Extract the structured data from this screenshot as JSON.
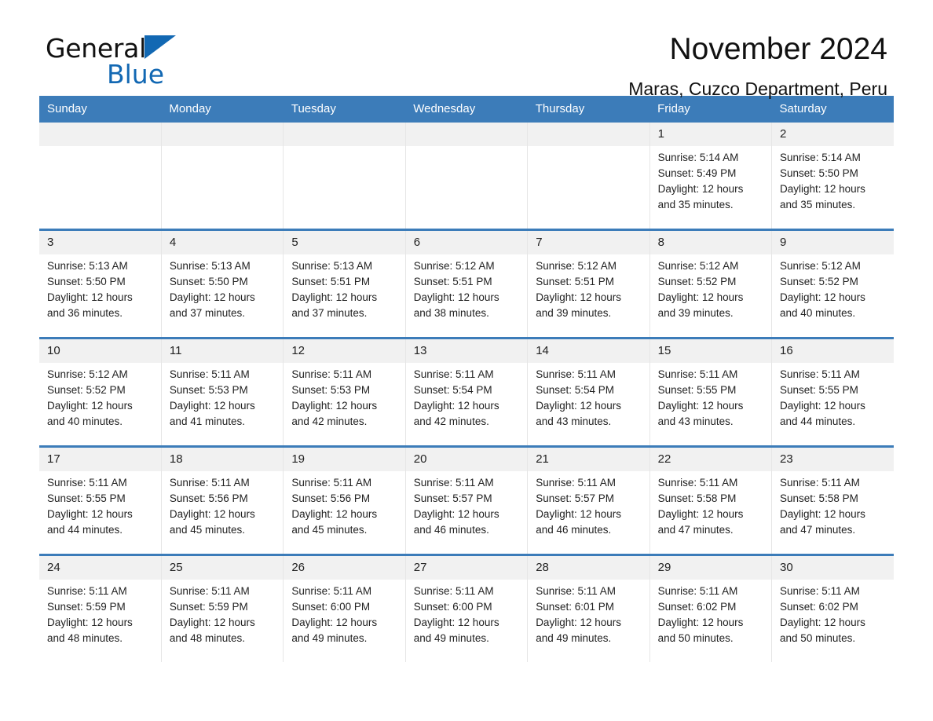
{
  "brand": {
    "name_part1": "General",
    "name_part2": "Blue",
    "accent_color": "#1268b3"
  },
  "header": {
    "title": "November 2024",
    "subtitle": "Maras, Cuzco Department, Peru"
  },
  "theme": {
    "header_bg": "#3c7cb9",
    "daynum_bg": "#f1f1f1",
    "cell_bg": "#ffffff"
  },
  "weekday_headers": [
    "Sunday",
    "Monday",
    "Tuesday",
    "Wednesday",
    "Thursday",
    "Friday",
    "Saturday"
  ],
  "weeks": [
    [
      {
        "day": "",
        "sunrise": "",
        "sunset": "",
        "daylight_line1": "",
        "daylight_line2": "",
        "blank": true
      },
      {
        "day": "",
        "sunrise": "",
        "sunset": "",
        "daylight_line1": "",
        "daylight_line2": "",
        "blank": true
      },
      {
        "day": "",
        "sunrise": "",
        "sunset": "",
        "daylight_line1": "",
        "daylight_line2": "",
        "blank": true
      },
      {
        "day": "",
        "sunrise": "",
        "sunset": "",
        "daylight_line1": "",
        "daylight_line2": "",
        "blank": true
      },
      {
        "day": "",
        "sunrise": "",
        "sunset": "",
        "daylight_line1": "",
        "daylight_line2": "",
        "blank": true
      },
      {
        "day": "1",
        "sunrise": "Sunrise: 5:14 AM",
        "sunset": "Sunset: 5:49 PM",
        "daylight_line1": "Daylight: 12 hours",
        "daylight_line2": "and 35 minutes.",
        "blank": false
      },
      {
        "day": "2",
        "sunrise": "Sunrise: 5:14 AM",
        "sunset": "Sunset: 5:50 PM",
        "daylight_line1": "Daylight: 12 hours",
        "daylight_line2": "and 35 minutes.",
        "blank": false
      }
    ],
    [
      {
        "day": "3",
        "sunrise": "Sunrise: 5:13 AM",
        "sunset": "Sunset: 5:50 PM",
        "daylight_line1": "Daylight: 12 hours",
        "daylight_line2": "and 36 minutes.",
        "blank": false
      },
      {
        "day": "4",
        "sunrise": "Sunrise: 5:13 AM",
        "sunset": "Sunset: 5:50 PM",
        "daylight_line1": "Daylight: 12 hours",
        "daylight_line2": "and 37 minutes.",
        "blank": false
      },
      {
        "day": "5",
        "sunrise": "Sunrise: 5:13 AM",
        "sunset": "Sunset: 5:51 PM",
        "daylight_line1": "Daylight: 12 hours",
        "daylight_line2": "and 37 minutes.",
        "blank": false
      },
      {
        "day": "6",
        "sunrise": "Sunrise: 5:12 AM",
        "sunset": "Sunset: 5:51 PM",
        "daylight_line1": "Daylight: 12 hours",
        "daylight_line2": "and 38 minutes.",
        "blank": false
      },
      {
        "day": "7",
        "sunrise": "Sunrise: 5:12 AM",
        "sunset": "Sunset: 5:51 PM",
        "daylight_line1": "Daylight: 12 hours",
        "daylight_line2": "and 39 minutes.",
        "blank": false
      },
      {
        "day": "8",
        "sunrise": "Sunrise: 5:12 AM",
        "sunset": "Sunset: 5:52 PM",
        "daylight_line1": "Daylight: 12 hours",
        "daylight_line2": "and 39 minutes.",
        "blank": false
      },
      {
        "day": "9",
        "sunrise": "Sunrise: 5:12 AM",
        "sunset": "Sunset: 5:52 PM",
        "daylight_line1": "Daylight: 12 hours",
        "daylight_line2": "and 40 minutes.",
        "blank": false
      }
    ],
    [
      {
        "day": "10",
        "sunrise": "Sunrise: 5:12 AM",
        "sunset": "Sunset: 5:52 PM",
        "daylight_line1": "Daylight: 12 hours",
        "daylight_line2": "and 40 minutes.",
        "blank": false
      },
      {
        "day": "11",
        "sunrise": "Sunrise: 5:11 AM",
        "sunset": "Sunset: 5:53 PM",
        "daylight_line1": "Daylight: 12 hours",
        "daylight_line2": "and 41 minutes.",
        "blank": false
      },
      {
        "day": "12",
        "sunrise": "Sunrise: 5:11 AM",
        "sunset": "Sunset: 5:53 PM",
        "daylight_line1": "Daylight: 12 hours",
        "daylight_line2": "and 42 minutes.",
        "blank": false
      },
      {
        "day": "13",
        "sunrise": "Sunrise: 5:11 AM",
        "sunset": "Sunset: 5:54 PM",
        "daylight_line1": "Daylight: 12 hours",
        "daylight_line2": "and 42 minutes.",
        "blank": false
      },
      {
        "day": "14",
        "sunrise": "Sunrise: 5:11 AM",
        "sunset": "Sunset: 5:54 PM",
        "daylight_line1": "Daylight: 12 hours",
        "daylight_line2": "and 43 minutes.",
        "blank": false
      },
      {
        "day": "15",
        "sunrise": "Sunrise: 5:11 AM",
        "sunset": "Sunset: 5:55 PM",
        "daylight_line1": "Daylight: 12 hours",
        "daylight_line2": "and 43 minutes.",
        "blank": false
      },
      {
        "day": "16",
        "sunrise": "Sunrise: 5:11 AM",
        "sunset": "Sunset: 5:55 PM",
        "daylight_line1": "Daylight: 12 hours",
        "daylight_line2": "and 44 minutes.",
        "blank": false
      }
    ],
    [
      {
        "day": "17",
        "sunrise": "Sunrise: 5:11 AM",
        "sunset": "Sunset: 5:55 PM",
        "daylight_line1": "Daylight: 12 hours",
        "daylight_line2": "and 44 minutes.",
        "blank": false
      },
      {
        "day": "18",
        "sunrise": "Sunrise: 5:11 AM",
        "sunset": "Sunset: 5:56 PM",
        "daylight_line1": "Daylight: 12 hours",
        "daylight_line2": "and 45 minutes.",
        "blank": false
      },
      {
        "day": "19",
        "sunrise": "Sunrise: 5:11 AM",
        "sunset": "Sunset: 5:56 PM",
        "daylight_line1": "Daylight: 12 hours",
        "daylight_line2": "and 45 minutes.",
        "blank": false
      },
      {
        "day": "20",
        "sunrise": "Sunrise: 5:11 AM",
        "sunset": "Sunset: 5:57 PM",
        "daylight_line1": "Daylight: 12 hours",
        "daylight_line2": "and 46 minutes.",
        "blank": false
      },
      {
        "day": "21",
        "sunrise": "Sunrise: 5:11 AM",
        "sunset": "Sunset: 5:57 PM",
        "daylight_line1": "Daylight: 12 hours",
        "daylight_line2": "and 46 minutes.",
        "blank": false
      },
      {
        "day": "22",
        "sunrise": "Sunrise: 5:11 AM",
        "sunset": "Sunset: 5:58 PM",
        "daylight_line1": "Daylight: 12 hours",
        "daylight_line2": "and 47 minutes.",
        "blank": false
      },
      {
        "day": "23",
        "sunrise": "Sunrise: 5:11 AM",
        "sunset": "Sunset: 5:58 PM",
        "daylight_line1": "Daylight: 12 hours",
        "daylight_line2": "and 47 minutes.",
        "blank": false
      }
    ],
    [
      {
        "day": "24",
        "sunrise": "Sunrise: 5:11 AM",
        "sunset": "Sunset: 5:59 PM",
        "daylight_line1": "Daylight: 12 hours",
        "daylight_line2": "and 48 minutes.",
        "blank": false
      },
      {
        "day": "25",
        "sunrise": "Sunrise: 5:11 AM",
        "sunset": "Sunset: 5:59 PM",
        "daylight_line1": "Daylight: 12 hours",
        "daylight_line2": "and 48 minutes.",
        "blank": false
      },
      {
        "day": "26",
        "sunrise": "Sunrise: 5:11 AM",
        "sunset": "Sunset: 6:00 PM",
        "daylight_line1": "Daylight: 12 hours",
        "daylight_line2": "and 49 minutes.",
        "blank": false
      },
      {
        "day": "27",
        "sunrise": "Sunrise: 5:11 AM",
        "sunset": "Sunset: 6:00 PM",
        "daylight_line1": "Daylight: 12 hours",
        "daylight_line2": "and 49 minutes.",
        "blank": false
      },
      {
        "day": "28",
        "sunrise": "Sunrise: 5:11 AM",
        "sunset": "Sunset: 6:01 PM",
        "daylight_line1": "Daylight: 12 hours",
        "daylight_line2": "and 49 minutes.",
        "blank": false
      },
      {
        "day": "29",
        "sunrise": "Sunrise: 5:11 AM",
        "sunset": "Sunset: 6:02 PM",
        "daylight_line1": "Daylight: 12 hours",
        "daylight_line2": "and 50 minutes.",
        "blank": false
      },
      {
        "day": "30",
        "sunrise": "Sunrise: 5:11 AM",
        "sunset": "Sunset: 6:02 PM",
        "daylight_line1": "Daylight: 12 hours",
        "daylight_line2": "and 50 minutes.",
        "blank": false
      }
    ]
  ]
}
